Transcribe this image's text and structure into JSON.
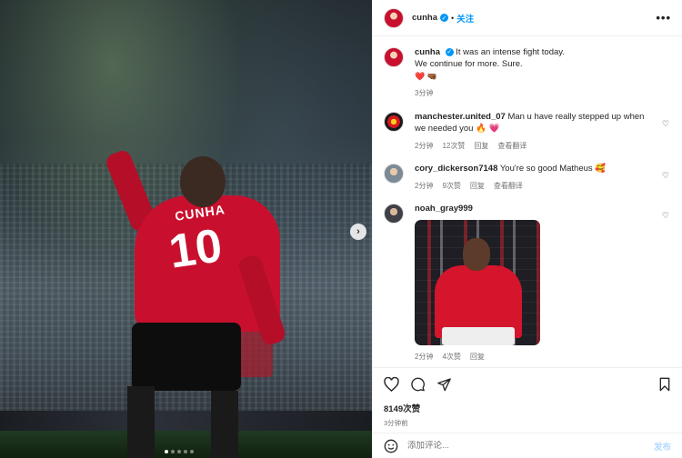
{
  "post": {
    "username": "cunha",
    "follow_label": "关注",
    "separator": "•",
    "more_label": "•••",
    "caption_line1": "It was an intense fight today.",
    "caption_line2": "We continue for more. Sure.",
    "caption_emojis": "❤️ 🤜🏾",
    "caption_time": "3分钟",
    "jersey_name": "CUNHA",
    "jersey_number": "10",
    "carousel": {
      "total_dots": 5,
      "active_index": 0
    }
  },
  "comments": [
    {
      "username": "manchester.united_07",
      "text": "Man u have really stepped up when we needed you 🔥 💗",
      "time": "2分钟",
      "likes": "12次赞",
      "reply": "回复",
      "translate": "查看翻译"
    },
    {
      "username": "cory_dickerson7148",
      "text": "You're so good Matheus 🥰",
      "time": "2分钟",
      "likes": "9次赞",
      "reply": "回复",
      "translate": "查看翻译"
    },
    {
      "username": "noah_gray999",
      "text": "",
      "time": "2分钟",
      "likes": "4次赞",
      "reply": "回复"
    }
  ],
  "actions": {
    "likes_count": "8149次赞",
    "posted_time": "3分钟前"
  },
  "comment_box": {
    "placeholder": "添加评论...",
    "post_label": "发布"
  },
  "icons": {
    "next": "chevron-right-icon",
    "like": "heart-icon",
    "comment": "comment-icon",
    "share": "paper-plane-icon",
    "save": "bookmark-icon",
    "emoji": "smiley-icon",
    "more": "more-horizontal-icon"
  },
  "colors": {
    "accent": "#0095f6",
    "jersey_red": "#c8102e",
    "muted_text": "#737373",
    "post_disabled": "#b3dbff"
  }
}
